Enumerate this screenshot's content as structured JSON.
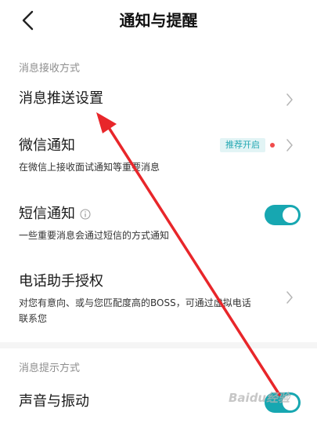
{
  "header": {
    "title": "通知与提醒",
    "back_icon": "chevron-left-icon"
  },
  "sections": {
    "receive": {
      "label": "消息接收方式",
      "push_settings": {
        "title": "消息推送设置"
      },
      "wechat": {
        "title": "微信通知",
        "subtitle": "在微信上接收面试通知等重要消息",
        "badge": "推荐开启"
      },
      "sms": {
        "title": "短信通知",
        "subtitle": "一些重要消息会通过短信的方式通知",
        "enabled": true
      },
      "phone_assistant": {
        "title": "电话助手授权",
        "subtitle_line1": "对您有意向、或与您匹配度高的BOSS，可通过虚拟电话",
        "subtitle_line2": "联系您"
      }
    },
    "prompt": {
      "label": "消息提示方式",
      "sound_vibration": {
        "title": "声音与振动",
        "enabled": true
      }
    }
  },
  "colors": {
    "accent": "#17a7b1",
    "badge_bg": "#e2f4f5",
    "red_dot": "#f04b4b",
    "annotation_arrow": "#e8262a"
  },
  "watermark": {
    "text": "Baidu经验"
  }
}
